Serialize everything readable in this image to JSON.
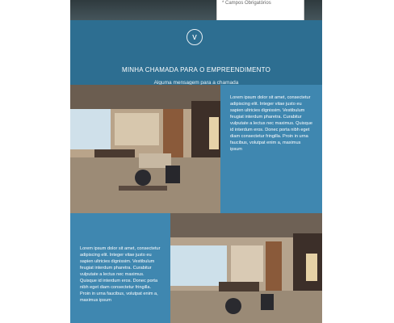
{
  "form": {
    "required_note": "* Campos Obrigatórios"
  },
  "banner": {
    "arrow_glyph": "v",
    "headline": "MINHA CHAMADA PARA O EMPREENDIMENTO",
    "subline": "Alguma mensagem para a chamada"
  },
  "sections": [
    {
      "text": "Lorem ipsum dolor sit amet, consectetur adipiscing elit. Integer vitae justo eu sapien ultricies dignissim. Vestibulum feugiat interdum pharetra. Curabitur vulputate a lectus nec maximus. Quisque id interdum eros. Donec porta nibh eget diam consectetur fringilla. Proin in urna faucibus, volutpat enim a, maximus ipsum"
    },
    {
      "text": "Lorem ipsum dolor sit amet, consectetur adipiscing elit. Integer vitae justo eu sapien ultricies dignissim. Vestibulum feugiat interdum pharetra. Curabitur vulputate a lectus nec maximus. Quisque id interdum eros. Donec porta nibh eget diam consectetur fringilla. Proin in urna faucibus, volutpat enim a, maximus ipsum"
    }
  ],
  "colors": {
    "banner": "#2d6e91",
    "text_block": "#3f87b0",
    "hero_dark": "#2f3a3e"
  }
}
